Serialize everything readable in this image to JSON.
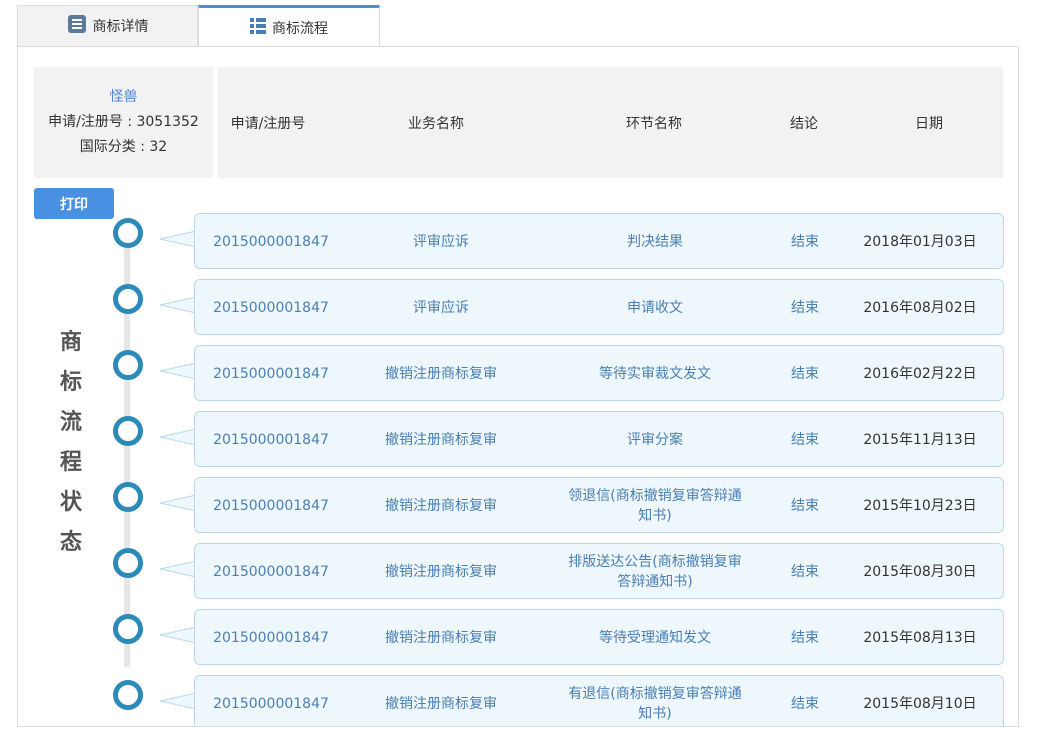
{
  "tabs": [
    {
      "label": "商标详情",
      "active": false
    },
    {
      "label": "商标流程",
      "active": true
    }
  ],
  "summary": {
    "name": "怪兽",
    "reg_line": "申请/注册号 : 3051352",
    "class_line": "国际分类 : 32"
  },
  "header": {
    "reg_no": "申请/注册号",
    "business": "业务名称",
    "step": "环节名称",
    "result": "结论",
    "date": "日期"
  },
  "print_label": "打印",
  "side_label": [
    "商",
    "标",
    "流",
    "程",
    "状",
    "态"
  ],
  "rows": [
    {
      "reg_no": "2015000001847",
      "business": "评审应诉",
      "step": "判决结果",
      "result": "结束",
      "date": "2018年01月03日"
    },
    {
      "reg_no": "2015000001847",
      "business": "评审应诉",
      "step": "申请收文",
      "result": "结束",
      "date": "2016年08月02日"
    },
    {
      "reg_no": "2015000001847",
      "business": "撤销注册商标复审",
      "step": "等待实审裁文发文",
      "result": "结束",
      "date": "2016年02月22日"
    },
    {
      "reg_no": "2015000001847",
      "business": "撤销注册商标复审",
      "step": "评审分案",
      "result": "结束",
      "date": "2015年11月13日"
    },
    {
      "reg_no": "2015000001847",
      "business": "撤销注册商标复审",
      "step": "领退信(商标撤销复审答辩通知书)",
      "result": "结束",
      "date": "2015年10月23日"
    },
    {
      "reg_no": "2015000001847",
      "business": "撤销注册商标复审",
      "step": "排版送达公告(商标撤销复审答辩通知书)",
      "result": "结束",
      "date": "2015年08月30日"
    },
    {
      "reg_no": "2015000001847",
      "business": "撤销注册商标复审",
      "step": "等待受理通知发文",
      "result": "结束",
      "date": "2015年08月13日"
    },
    {
      "reg_no": "2015000001847",
      "business": "撤销注册商标复审",
      "step": "有退信(商标撤销复审答辩通知书)",
      "result": "结束",
      "date": "2015年08月10日"
    }
  ],
  "colors": {
    "accent": "#4a90e2",
    "node": "#2c8ab8",
    "card_bg": "#eef7fb",
    "link_text": "#4a7fb5"
  }
}
